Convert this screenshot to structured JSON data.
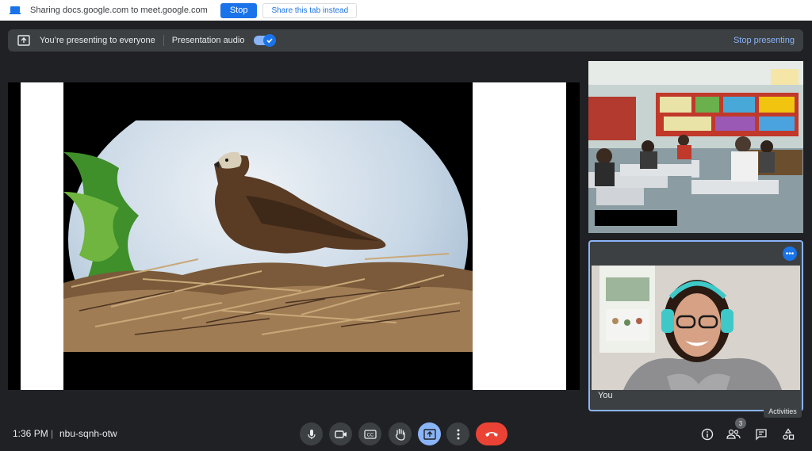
{
  "share_bar": {
    "text": "Sharing docs.google.com to meet.google.com",
    "stop_label": "Stop",
    "share_tab_label": "Share this tab instead"
  },
  "present_bar": {
    "status_text": "You’re presenting to everyone",
    "audio_label": "Presentation audio",
    "audio_on": true,
    "stop_presenting_label": "Stop presenting"
  },
  "tiles": {
    "self_label": "You"
  },
  "footer": {
    "time": "1:36 PM",
    "separator": "|",
    "meeting_code": "nbu-sqnh-otw",
    "participant_count": "3",
    "tooltip": "Activities"
  },
  "controls": {
    "center": [
      "mic-icon",
      "camera-icon",
      "captions-icon",
      "raise-hand-icon",
      "present-icon",
      "more-options-icon",
      "leave-call-icon"
    ],
    "right": [
      "info-icon",
      "people-icon",
      "chat-icon",
      "activities-icon"
    ]
  },
  "colors": {
    "background": "#202124",
    "accent": "#1a73e8",
    "accent_light": "#8ab4f8",
    "leave": "#ea4335",
    "panel": "#3c4043"
  }
}
